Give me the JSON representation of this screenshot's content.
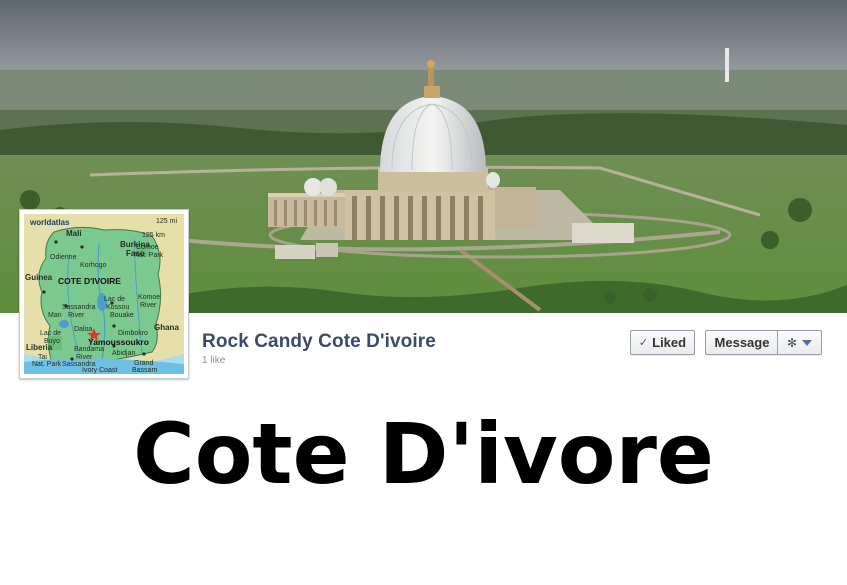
{
  "page": {
    "name": "Rock Candy Cote D'ivoire",
    "likes": "1 like"
  },
  "actions": {
    "liked_label": "Liked",
    "message_label": "Message",
    "settings_icon": "gear-icon",
    "dropdown_icon": "caret-down-icon"
  },
  "cover": {
    "subject": "aerial-photo-basilica"
  },
  "profile_map": {
    "brand": "worldatlas",
    "scale_mi": "125 mi",
    "scale_km": "125 km",
    "country": "COTE D'IVOIRE",
    "capital": "Yamoussoukro",
    "labels": {
      "mali": "Mali",
      "burkina": "Burkina",
      "faso": "Faso",
      "odienne": "Odienne",
      "korhogo": "Korhogo",
      "guinea": "Guinea",
      "comoe1": "Comoe",
      "comoe2": "Nat. Park",
      "lac1": "Lac de",
      "lac2": "Kossou",
      "sassandra1": "Sassandra",
      "sassandra2": "River",
      "man": "Man",
      "komoe1": "Komoe",
      "komoe2": "River",
      "bouake": "Bouake",
      "ghana": "Ghana",
      "daloa": "Daloa",
      "dimbokro": "Dimbokro",
      "lacdebuyo1": "Lac de",
      "lacdebuyo2": "Buyo",
      "bandama1": "Bandama",
      "bandama2": "River",
      "abidjan": "Abidjan",
      "liberia": "Liberia",
      "tai1": "Tai",
      "tai2": "Nat. Park",
      "sassandra_town": "Sassandra",
      "ivory_coast": "Ivory Coast",
      "grand1": "Grand",
      "grand2": "Bassam"
    }
  },
  "caption": "Cote D'ivore",
  "colors": {
    "name_blue": "#3b4a6b",
    "map_land": "#7cc98f",
    "map_water": "#a9dcf0",
    "button_border": "#999fab"
  }
}
